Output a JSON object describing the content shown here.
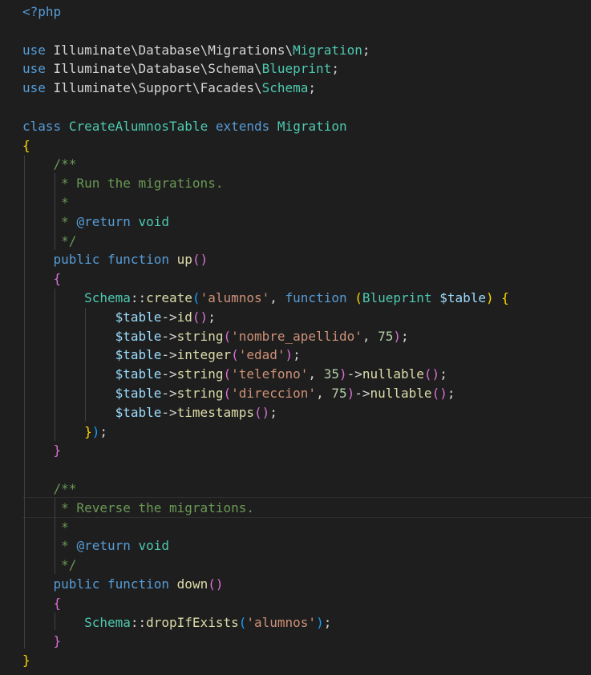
{
  "colors": {
    "background": "#1e1e1e",
    "keyword": "#569cd6",
    "plain": "#d4d4d4",
    "class": "#4ec9b0",
    "function": "#dcdcaa",
    "variable": "#9cdcfe",
    "string": "#ce9178",
    "number": "#b5cea8",
    "comment": "#6a9955",
    "bracket_1": "#ffd700",
    "bracket_2": "#da70d6",
    "bracket_3": "#179fff"
  },
  "code": {
    "lines": [
      [
        {
          "t": "<?php",
          "c": "kw"
        }
      ],
      [],
      [
        {
          "t": "use",
          "c": "kw"
        },
        {
          "t": " Illuminate\\Database\\Migrations\\",
          "c": "pl"
        },
        {
          "t": "Migration",
          "c": "cls"
        },
        {
          "t": ";",
          "c": "pl"
        }
      ],
      [
        {
          "t": "use",
          "c": "kw"
        },
        {
          "t": " Illuminate\\Database\\Schema\\",
          "c": "pl"
        },
        {
          "t": "Blueprint",
          "c": "cls"
        },
        {
          "t": ";",
          "c": "pl"
        }
      ],
      [
        {
          "t": "use",
          "c": "kw"
        },
        {
          "t": " Illuminate\\Support\\Facades\\",
          "c": "pl"
        },
        {
          "t": "Schema",
          "c": "cls"
        },
        {
          "t": ";",
          "c": "pl"
        }
      ],
      [],
      [
        {
          "t": "class",
          "c": "kw"
        },
        {
          "t": " ",
          "c": "pl"
        },
        {
          "t": "CreateAlumnosTable",
          "c": "cls"
        },
        {
          "t": " ",
          "c": "pl"
        },
        {
          "t": "extends",
          "c": "kw"
        },
        {
          "t": " ",
          "c": "pl"
        },
        {
          "t": "Migration",
          "c": "cls"
        }
      ],
      [
        {
          "t": "{",
          "c": "b1"
        }
      ],
      [
        {
          "t": "    /**",
          "c": "cm"
        }
      ],
      [
        {
          "t": "     * Run the migrations.",
          "c": "cm"
        }
      ],
      [
        {
          "t": "     *",
          "c": "cm"
        }
      ],
      [
        {
          "t": "     * ",
          "c": "cm"
        },
        {
          "t": "@return",
          "c": "cmk"
        },
        {
          "t": " ",
          "c": "cm"
        },
        {
          "t": "void",
          "c": "cls"
        }
      ],
      [
        {
          "t": "     */",
          "c": "cm"
        }
      ],
      [
        {
          "t": "    ",
          "c": "pl"
        },
        {
          "t": "public",
          "c": "kw"
        },
        {
          "t": " ",
          "c": "pl"
        },
        {
          "t": "function",
          "c": "kw"
        },
        {
          "t": " ",
          "c": "pl"
        },
        {
          "t": "up",
          "c": "fn"
        },
        {
          "t": "()",
          "c": "b2"
        }
      ],
      [
        {
          "t": "    ",
          "c": "pl"
        },
        {
          "t": "{",
          "c": "b2"
        }
      ],
      [
        {
          "t": "        ",
          "c": "pl"
        },
        {
          "t": "Schema",
          "c": "cls"
        },
        {
          "t": "::",
          "c": "pl"
        },
        {
          "t": "create",
          "c": "fn"
        },
        {
          "t": "(",
          "c": "b3"
        },
        {
          "t": "'alumnos'",
          "c": "str"
        },
        {
          "t": ", ",
          "c": "pl"
        },
        {
          "t": "function",
          "c": "kw"
        },
        {
          "t": " ",
          "c": "pl"
        },
        {
          "t": "(",
          "c": "b1"
        },
        {
          "t": "Blueprint",
          "c": "cls"
        },
        {
          "t": " ",
          "c": "pl"
        },
        {
          "t": "$table",
          "c": "var"
        },
        {
          "t": ")",
          "c": "b1"
        },
        {
          "t": " ",
          "c": "pl"
        },
        {
          "t": "{",
          "c": "b1"
        }
      ],
      [
        {
          "t": "            ",
          "c": "pl"
        },
        {
          "t": "$table",
          "c": "var"
        },
        {
          "t": "->",
          "c": "pl"
        },
        {
          "t": "id",
          "c": "fn"
        },
        {
          "t": "()",
          "c": "b2"
        },
        {
          "t": ";",
          "c": "pl"
        }
      ],
      [
        {
          "t": "            ",
          "c": "pl"
        },
        {
          "t": "$table",
          "c": "var"
        },
        {
          "t": "->",
          "c": "pl"
        },
        {
          "t": "string",
          "c": "fn"
        },
        {
          "t": "(",
          "c": "b2"
        },
        {
          "t": "'nombre_apellido'",
          "c": "str"
        },
        {
          "t": ", ",
          "c": "pl"
        },
        {
          "t": "75",
          "c": "num"
        },
        {
          "t": ")",
          "c": "b2"
        },
        {
          "t": ";",
          "c": "pl"
        }
      ],
      [
        {
          "t": "            ",
          "c": "pl"
        },
        {
          "t": "$table",
          "c": "var"
        },
        {
          "t": "->",
          "c": "pl"
        },
        {
          "t": "integer",
          "c": "fn"
        },
        {
          "t": "(",
          "c": "b2"
        },
        {
          "t": "'edad'",
          "c": "str"
        },
        {
          "t": ")",
          "c": "b2"
        },
        {
          "t": ";",
          "c": "pl"
        }
      ],
      [
        {
          "t": "            ",
          "c": "pl"
        },
        {
          "t": "$table",
          "c": "var"
        },
        {
          "t": "->",
          "c": "pl"
        },
        {
          "t": "string",
          "c": "fn"
        },
        {
          "t": "(",
          "c": "b2"
        },
        {
          "t": "'telefono'",
          "c": "str"
        },
        {
          "t": ", ",
          "c": "pl"
        },
        {
          "t": "35",
          "c": "num"
        },
        {
          "t": ")",
          "c": "b2"
        },
        {
          "t": "->",
          "c": "pl"
        },
        {
          "t": "nullable",
          "c": "fn"
        },
        {
          "t": "()",
          "c": "b2"
        },
        {
          "t": ";",
          "c": "pl"
        }
      ],
      [
        {
          "t": "            ",
          "c": "pl"
        },
        {
          "t": "$table",
          "c": "var"
        },
        {
          "t": "->",
          "c": "pl"
        },
        {
          "t": "string",
          "c": "fn"
        },
        {
          "t": "(",
          "c": "b2"
        },
        {
          "t": "'direccion'",
          "c": "str"
        },
        {
          "t": ", ",
          "c": "pl"
        },
        {
          "t": "75",
          "c": "num"
        },
        {
          "t": ")",
          "c": "b2"
        },
        {
          "t": "->",
          "c": "pl"
        },
        {
          "t": "nullable",
          "c": "fn"
        },
        {
          "t": "()",
          "c": "b2"
        },
        {
          "t": ";",
          "c": "pl"
        }
      ],
      [
        {
          "t": "            ",
          "c": "pl"
        },
        {
          "t": "$table",
          "c": "var"
        },
        {
          "t": "->",
          "c": "pl"
        },
        {
          "t": "timestamps",
          "c": "fn"
        },
        {
          "t": "()",
          "c": "b2"
        },
        {
          "t": ";",
          "c": "pl"
        }
      ],
      [
        {
          "t": "        ",
          "c": "pl"
        },
        {
          "t": "}",
          "c": "b1"
        },
        {
          "t": ")",
          "c": "b3"
        },
        {
          "t": ";",
          "c": "pl"
        }
      ],
      [
        {
          "t": "    ",
          "c": "pl"
        },
        {
          "t": "}",
          "c": "b2"
        }
      ],
      [],
      [
        {
          "t": "    /**",
          "c": "cm"
        }
      ],
      [
        {
          "t": "     * Reverse the migrations.",
          "c": "cm"
        }
      ],
      [
        {
          "t": "     *",
          "c": "cm"
        }
      ],
      [
        {
          "t": "     * ",
          "c": "cm"
        },
        {
          "t": "@return",
          "c": "cmk"
        },
        {
          "t": " ",
          "c": "cm"
        },
        {
          "t": "void",
          "c": "cls"
        }
      ],
      [
        {
          "t": "     */",
          "c": "cm"
        }
      ],
      [
        {
          "t": "    ",
          "c": "pl"
        },
        {
          "t": "public",
          "c": "kw"
        },
        {
          "t": " ",
          "c": "pl"
        },
        {
          "t": "function",
          "c": "kw"
        },
        {
          "t": " ",
          "c": "pl"
        },
        {
          "t": "down",
          "c": "fn"
        },
        {
          "t": "()",
          "c": "b2"
        }
      ],
      [
        {
          "t": "    ",
          "c": "pl"
        },
        {
          "t": "{",
          "c": "b2"
        }
      ],
      [
        {
          "t": "        ",
          "c": "pl"
        },
        {
          "t": "Schema",
          "c": "cls"
        },
        {
          "t": "::",
          "c": "pl"
        },
        {
          "t": "dropIfExists",
          "c": "fn"
        },
        {
          "t": "(",
          "c": "b3"
        },
        {
          "t": "'alumnos'",
          "c": "str"
        },
        {
          "t": ")",
          "c": "b3"
        },
        {
          "t": ";",
          "c": "pl"
        }
      ],
      [
        {
          "t": "    ",
          "c": "pl"
        },
        {
          "t": "}",
          "c": "b2"
        }
      ],
      [
        {
          "t": "}",
          "c": "b1"
        }
      ]
    ]
  }
}
